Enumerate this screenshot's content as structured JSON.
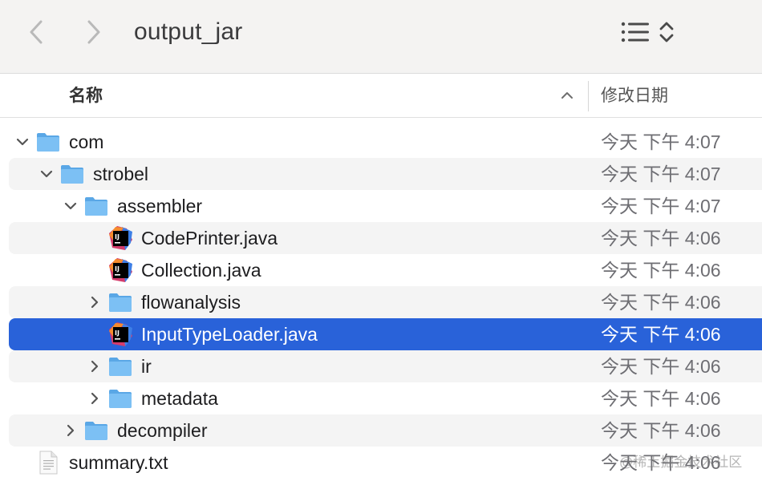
{
  "toolbar": {
    "title": "output_jar",
    "back_icon": "chevron-left-icon",
    "forward_icon": "chevron-right-icon",
    "view_icon": "list-view-icon"
  },
  "header": {
    "name_label": "名称",
    "date_label": "修改日期",
    "sort_icon": "chevron-up-icon"
  },
  "rows": [
    {
      "name": "com",
      "date": "今天 下午 4:07",
      "kind": "folder",
      "expanded": true,
      "depth": 0
    },
    {
      "name": "strobel",
      "date": "今天 下午 4:07",
      "kind": "folder",
      "expanded": true,
      "depth": 1
    },
    {
      "name": "assembler",
      "date": "今天 下午 4:07",
      "kind": "folder",
      "expanded": true,
      "depth": 2
    },
    {
      "name": "CodePrinter.java",
      "date": "今天 下午 4:06",
      "kind": "java-file",
      "depth": 3
    },
    {
      "name": "Collection.java",
      "date": "今天 下午 4:06",
      "kind": "java-file",
      "depth": 3
    },
    {
      "name": "flowanalysis",
      "date": "今天 下午 4:06",
      "kind": "folder",
      "expanded": false,
      "depth": 3
    },
    {
      "name": "InputTypeLoader.java",
      "date": "今天 下午 4:06",
      "kind": "java-file",
      "depth": 3,
      "selected": true
    },
    {
      "name": "ir",
      "date": "今天 下午 4:06",
      "kind": "folder",
      "expanded": false,
      "depth": 3
    },
    {
      "name": "metadata",
      "date": "今天 下午 4:06",
      "kind": "folder",
      "expanded": false,
      "depth": 3
    },
    {
      "name": "decompiler",
      "date": "今天 下午 4:06",
      "kind": "folder",
      "expanded": false,
      "depth": 2
    },
    {
      "name": "summary.txt",
      "date": "今天 下午 4:06",
      "kind": "text-file",
      "depth": 0
    }
  ],
  "watermark": "@稀土掘金技术社区",
  "colors": {
    "selection": "#2962d9",
    "folder": "#7cc0f4",
    "toolbar_bg": "#f4f3f2"
  }
}
